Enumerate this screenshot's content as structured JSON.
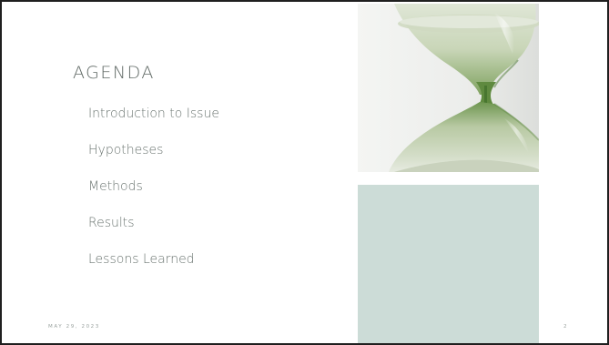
{
  "slide": {
    "title": "AGENDA",
    "items": [
      {
        "label": "Introduction to Issue"
      },
      {
        "label": "Hypotheses"
      },
      {
        "label": "Methods"
      },
      {
        "label": "Results"
      },
      {
        "label": "Lessons Learned"
      }
    ],
    "date": "MAY 29, 2023",
    "page_number": "2"
  },
  "image": {
    "icon": "hourglass-image"
  },
  "colors": {
    "block": "#ccdcd7",
    "text": "#6b7571",
    "title": "#5f6864",
    "glass_green": "#8fae74",
    "sand": "#d9e1cf"
  }
}
